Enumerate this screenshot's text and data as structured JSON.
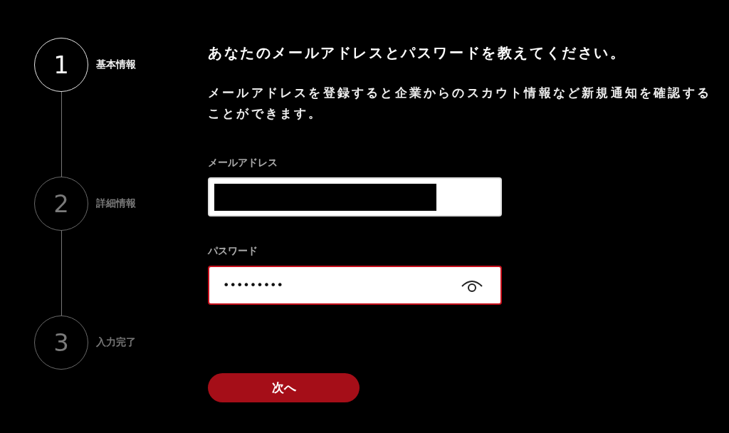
{
  "steps": [
    {
      "number": "1",
      "label": "基本情報",
      "selected": true
    },
    {
      "number": "2",
      "label": "詳細情報",
      "selected": false
    },
    {
      "number": "3",
      "label": "入力完了",
      "selected": false
    }
  ],
  "heading": "あなたのメールアドレスとパスワードを教えてください。",
  "description": "メールアドレスを登録すると企業からのスカウト情報など新規通知を確認することができます。",
  "fields": [
    {
      "label": "メールアドレス",
      "kind": "email",
      "redacted": true,
      "highlighted": false
    },
    {
      "label": "パスワード",
      "kind": "password",
      "value": "•••••••••",
      "highlighted": true
    }
  ],
  "button": "次へ"
}
